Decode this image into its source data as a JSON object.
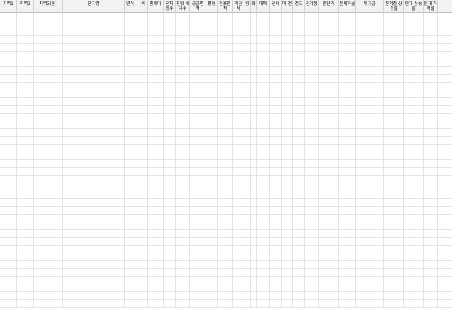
{
  "sheet": {
    "columns": [
      "지역1",
      "지역2",
      "지역3(동)",
      "단지명",
      "연식",
      "나이",
      "총세대",
      "전체동수",
      "평형\n세대수",
      "공급면적",
      "평형",
      "전용면적",
      "계단식",
      "방",
      "화",
      "매매",
      "전세",
      "매-전",
      "전고",
      "전저점",
      "평단가",
      "전세가율",
      "투자금",
      "전저점\n상승률",
      "현재\n상승률",
      "현재\n하락률"
    ],
    "rows": []
  }
}
